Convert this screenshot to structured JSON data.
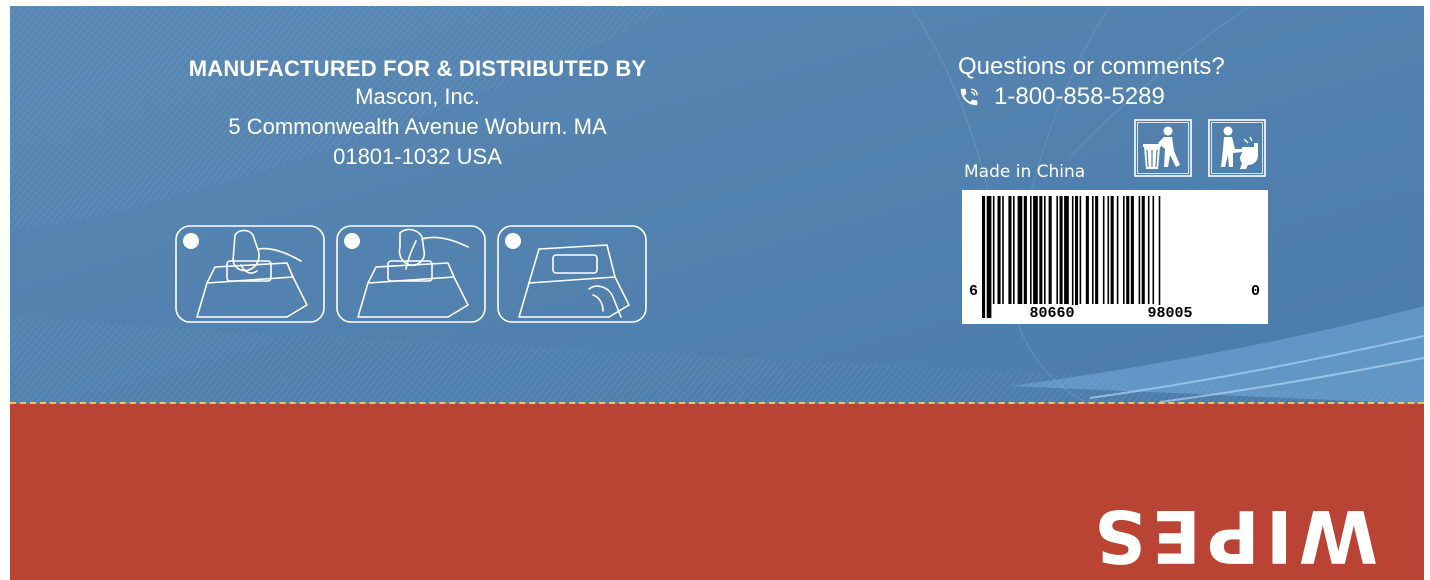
{
  "colors": {
    "panel_blue": "#4f80ad",
    "band_red": "#b94434",
    "stitch_yellow": "#d9cf6a",
    "text_white": "#ffffff"
  },
  "manufacturer": {
    "heading": "MANUFACTURED FOR & DISTRIBUTED BY",
    "company": "Mascon, Inc.",
    "street": "5 Commonwealth Avenue Woburn. MA",
    "postal": "01801-1032 USA"
  },
  "instructions": {
    "steps": [
      {
        "number": "1",
        "icon": "open-lid-icon"
      },
      {
        "number": "2",
        "icon": "pull-wipe-icon"
      },
      {
        "number": "3",
        "icon": "close-lid-icon"
      }
    ]
  },
  "contact": {
    "question": "Questions or comments?",
    "phone": "1-800-858-5289",
    "phone_icon": "phone-icon"
  },
  "origin": "Made in China",
  "disposal_symbols": [
    "trash-bin-disposal-icon",
    "do-not-flush-icon"
  ],
  "barcode": {
    "lead_digit": "6",
    "left_group": "80660",
    "right_group": "98005",
    "check_digit": "0"
  },
  "brand": "WIPES"
}
